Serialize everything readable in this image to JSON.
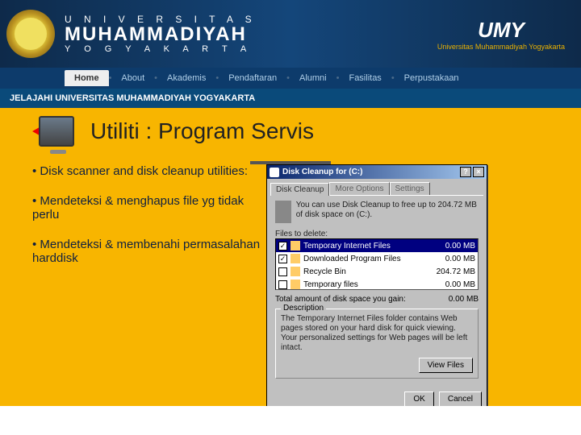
{
  "header": {
    "wm_top": "U N I V E R S I T A S",
    "wm_main": "MUHAMMADIYAH",
    "wm_bot": "Y O G Y A K A R T A",
    "umy": "UMY",
    "umy_tag": "Universitas Muhammadiyah Yogyakarta"
  },
  "nav": {
    "home": "Home",
    "items": [
      "About",
      "Akademis",
      "Pendaftaran",
      "Alumni",
      "Fasilitas",
      "Perpustakaan"
    ]
  },
  "sub_banner": "JELAJAHI UNIVERSITAS MUHAMMADIYAH YOGYAKARTA",
  "page_title": "Utiliti : Program Servis",
  "body": {
    "lead": "• Disk scanner and disk cleanup utilities:",
    "bullets": [
      "Mendeteksi & menghapus file yg tidak perlu",
      "Mendeteksi & membenahi permasalahan harddisk"
    ]
  },
  "disk_cleanup": {
    "title": "Disk Cleanup for  (C:)",
    "btn_help": "?",
    "btn_close": "×",
    "tabs": {
      "t1": "Disk Cleanup",
      "t2": "More Options",
      "t3": "Settings"
    },
    "info": "You can use Disk Cleanup to free up to 204.72 MB of disk space on  (C:).",
    "files_to_delete": "Files to delete:",
    "list": [
      {
        "name": "Temporary Internet Files",
        "size": "0.00 MB",
        "checked": true,
        "selected": true
      },
      {
        "name": "Downloaded Program Files",
        "size": "0.00 MB",
        "checked": true,
        "selected": false
      },
      {
        "name": "Recycle Bin",
        "size": "204.72 MB",
        "checked": false,
        "selected": false
      },
      {
        "name": "Temporary files",
        "size": "0.00 MB",
        "checked": false,
        "selected": false
      }
    ],
    "total_label": "Total amount of disk space you gain:",
    "total_value": "0.00 MB",
    "group_title": "Description",
    "desc": "The Temporary Internet Files folder contains Web pages stored on your hard disk for quick viewing. Your personalized settings for Web pages will be left intact.",
    "view_files": "View Files",
    "ok": "OK",
    "cancel": "Cancel"
  }
}
